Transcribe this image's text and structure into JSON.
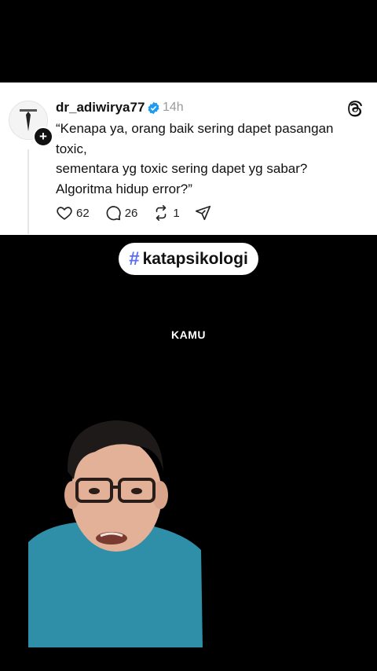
{
  "post": {
    "username": "dr_adiwirya77",
    "time": "14h",
    "lines": [
      "“Kenapa ya, orang baik sering dapet pasangan",
      "toxic,",
      "sementara yg toxic sering dapet yg sabar?",
      "Algoritma hidup error?”"
    ],
    "likes": "62",
    "comments": "26",
    "reposts": "1"
  },
  "hashtag": {
    "symbol": "#",
    "label": "katapsikologi"
  },
  "caption": "KAMU",
  "colors": {
    "background": "#000000",
    "card": "#ffffff",
    "verified": "#1d9bf0",
    "hashtag_accent": "#5b6df7"
  },
  "icons": [
    "verified-badge-icon",
    "threads-logo-icon",
    "heart-icon",
    "comment-icon",
    "repost-icon",
    "share-icon",
    "plus-icon"
  ]
}
